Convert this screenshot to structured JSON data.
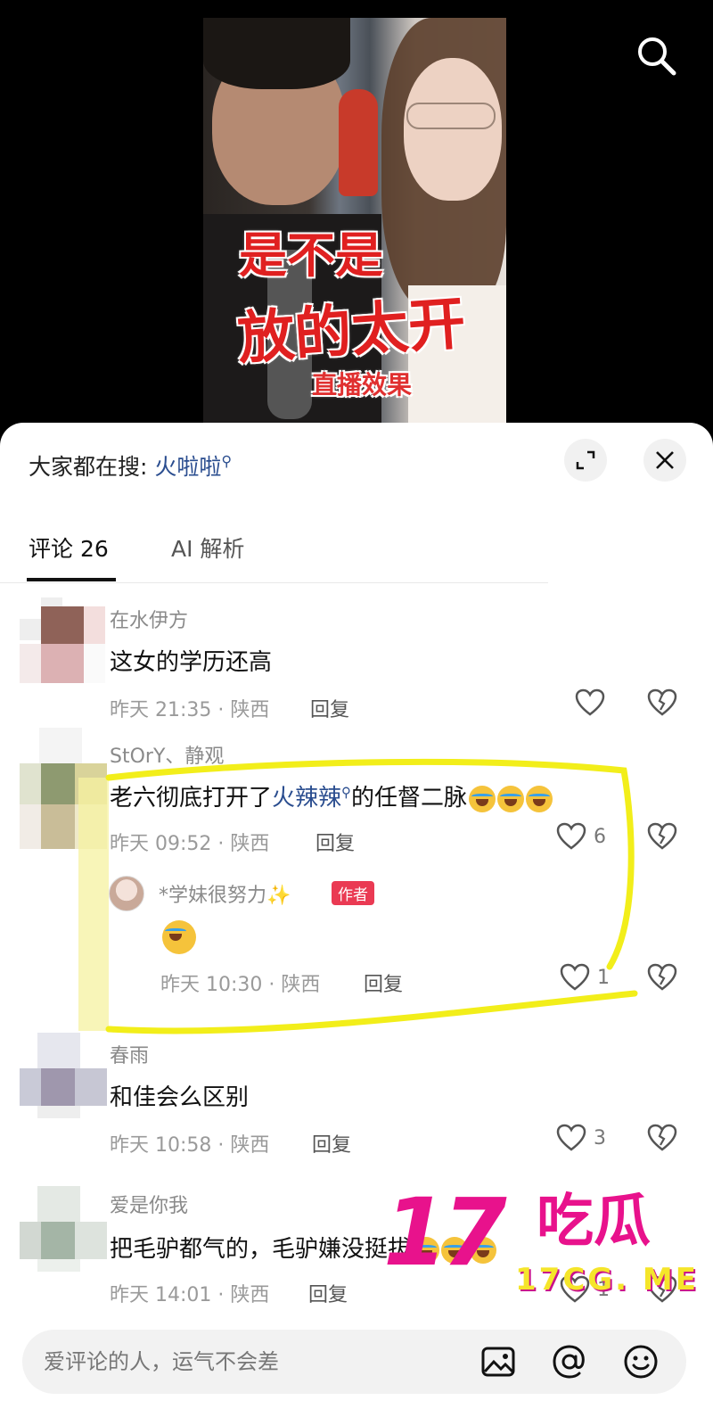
{
  "video": {
    "caption_line1": "是不是",
    "caption_line2": "放的太开",
    "caption_line3": "直播效果"
  },
  "panel": {
    "search_prefix": "大家都在搜: ",
    "search_keyword": "火啦啦",
    "tabs": [
      {
        "label": "评论 26"
      },
      {
        "label": "AI 解析"
      }
    ]
  },
  "comments": [
    {
      "user": "在水伊方",
      "text": "这女的学历还高",
      "meta": "昨天 21:35 · 陕西",
      "reply_label": "回复",
      "likes": ""
    },
    {
      "user": "StOrY、静观",
      "text_before": "老六彻底打开了",
      "text_keyword": "火辣辣",
      "text_after": "的任督二脉",
      "emoji_count": 3,
      "meta": "昨天 09:52 · 陕西",
      "reply_label": "回复",
      "likes": "6",
      "sub_reply": {
        "user": "*学妹很努力✨",
        "tag": "作者",
        "emoji_count": 1,
        "meta": "昨天 10:30 · 陕西",
        "reply_label": "回复",
        "likes": "1"
      }
    },
    {
      "user": "春雨",
      "text": "和佳会么区别",
      "meta": "昨天 10:58 · 陕西",
      "reply_label": "回复",
      "likes": "3"
    },
    {
      "user": "爱是你我",
      "text": "把毛驴都气的，毛驴嫌没挺拔",
      "emoji_count": 3,
      "meta": "昨天 14:01 · 陕西",
      "reply_label": "回复",
      "likes": "1"
    }
  ],
  "input": {
    "placeholder": "爱评论的人，运气不会差"
  },
  "watermark": {
    "big": "17",
    "cn": "吃瓜",
    "url": "17CG. ME"
  },
  "icons": [
    "search-icon",
    "expand-icon",
    "close-icon",
    "heart-icon",
    "broken-heart-icon",
    "image-icon",
    "at-icon",
    "emoji-icon"
  ],
  "colors": {
    "keyword": "#2a4d8f",
    "author_tag": "#ea3a53",
    "highlight": "#f2ee1a",
    "watermark": "#e8128c"
  }
}
